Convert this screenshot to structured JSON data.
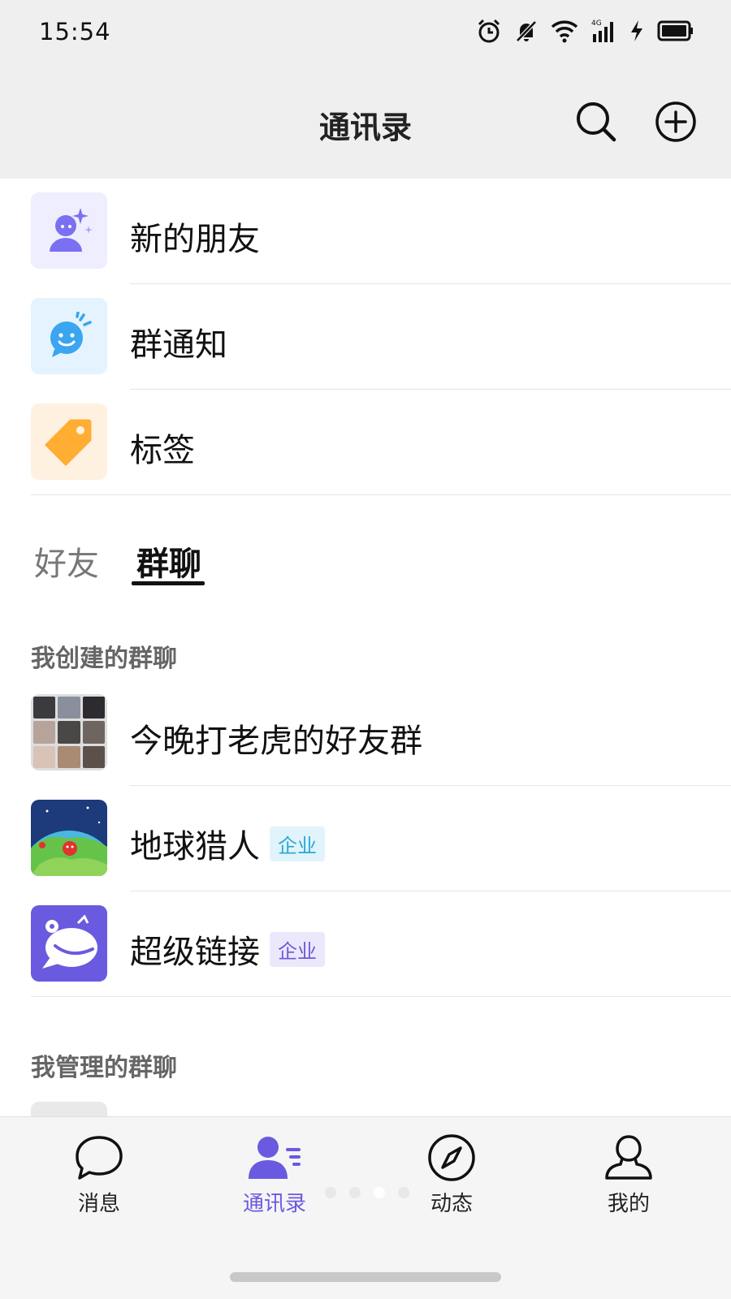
{
  "status_bar": {
    "time": "15:54",
    "network": "4G"
  },
  "header": {
    "title": "通讯录"
  },
  "function_items": [
    {
      "label": "新的朋友",
      "icon": "new-friend-icon",
      "icon_bg": "#efeefe",
      "icon_color": "#7b6ff2"
    },
    {
      "label": "群通知",
      "icon": "group-notice-icon",
      "icon_bg": "#e4f3fd",
      "icon_color": "#3aa5f0"
    },
    {
      "label": "标签",
      "icon": "tag-icon",
      "icon_bg": "#fff1e0",
      "icon_color": "#ffad33"
    }
  ],
  "tabs": [
    {
      "label": "好友",
      "active": false
    },
    {
      "label": "群聊",
      "active": true
    }
  ],
  "sections": [
    {
      "title": "我创建的群聊",
      "groups": [
        {
          "name": "今晚打老虎的好友群",
          "avatar": "nine-grid-avatar",
          "badge": ""
        },
        {
          "name": "地球猎人",
          "avatar": "earth-avatar",
          "badge": "企业"
        },
        {
          "name": "超级链接",
          "avatar": "super-link-avatar",
          "badge": "企业"
        }
      ]
    },
    {
      "title": "我管理的群聊",
      "groups": []
    }
  ],
  "bottom_nav": [
    {
      "label": "消息",
      "icon": "chat-bubble-icon",
      "active": false
    },
    {
      "label": "通讯录",
      "icon": "contacts-icon",
      "active": true
    },
    {
      "label": "动态",
      "icon": "compass-icon",
      "active": false
    },
    {
      "label": "我的",
      "icon": "person-icon",
      "active": false
    }
  ],
  "colors": {
    "accent": "#6a5ae0",
    "header_bg": "#efefef",
    "badge_cyan": "#2aa8d8",
    "badge_purple": "#6a5ad8"
  }
}
